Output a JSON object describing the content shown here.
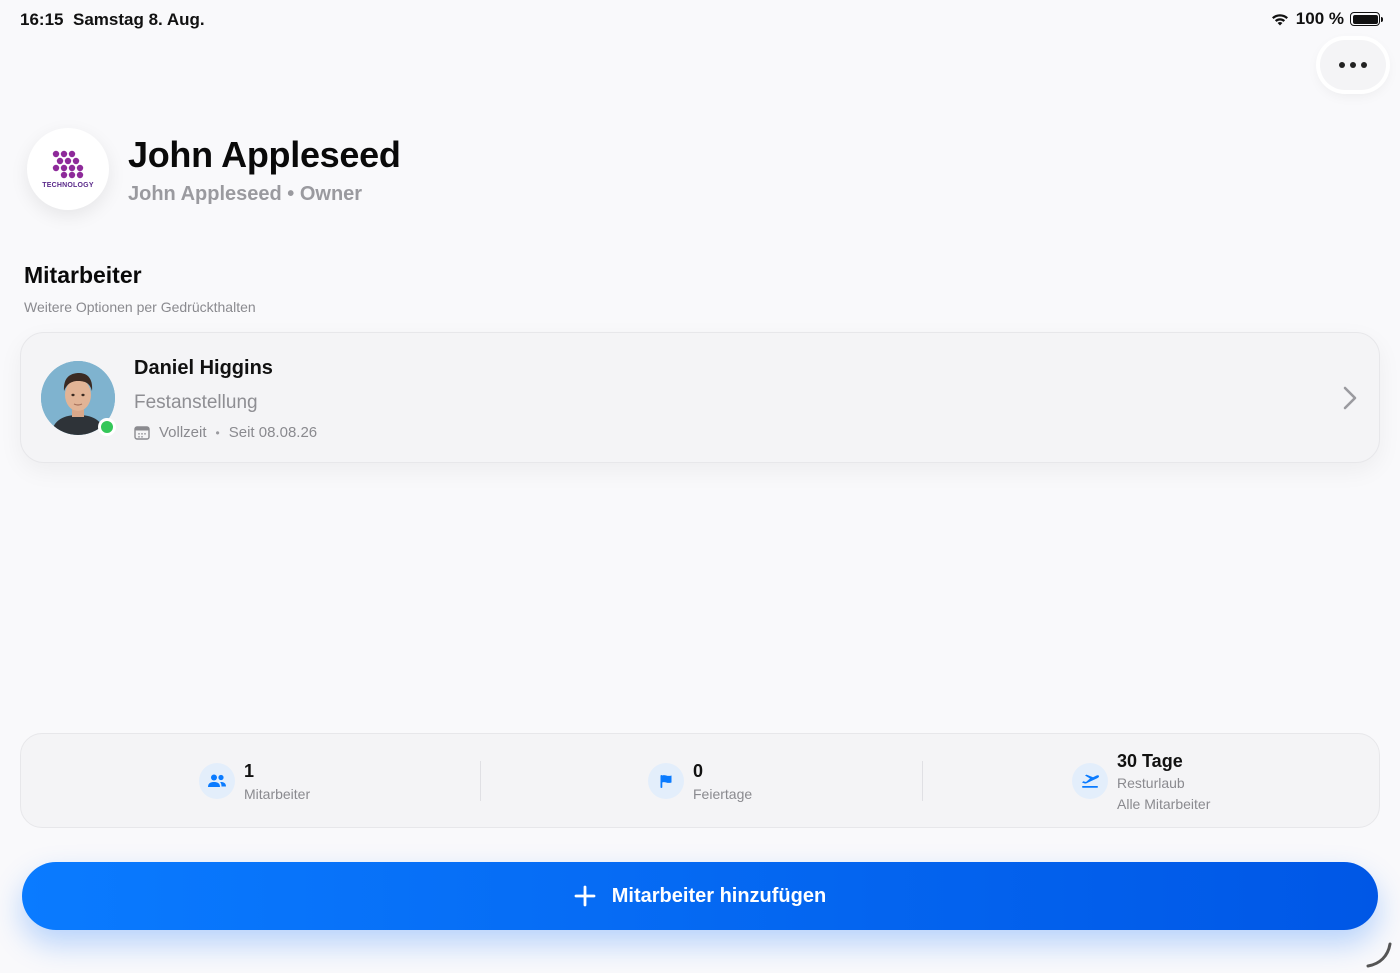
{
  "status_bar": {
    "time": "16:15",
    "date": "Samstag 8. Aug.",
    "battery": "100 %"
  },
  "header": {
    "logo_text": "TECHNOLOGY",
    "name": "John Appleseed",
    "subtitle": "John Appleseed • Owner"
  },
  "section": {
    "title": "Mitarbeiter",
    "subtitle": "Weitere Optionen per Gedrückthalten"
  },
  "employees": [
    {
      "name": "Daniel Higgins",
      "employment": "Festanstellung",
      "schedule": "Vollzeit",
      "since": "Seit 08.08.26",
      "online": true
    }
  ],
  "stats": [
    {
      "icon": "people-icon",
      "value": "1",
      "label": "Mitarbeiter",
      "sublabel": ""
    },
    {
      "icon": "flag-icon",
      "value": "0",
      "label": "Feiertage",
      "sublabel": ""
    },
    {
      "icon": "airplane-icon",
      "value": "30 Tage",
      "label": "Resturlaub",
      "sublabel": "Alle Mitarbeiter"
    }
  ],
  "add_button": {
    "label": "Mitarbeiter hinzufügen"
  },
  "colors": {
    "accent": "#0a7bff",
    "online": "#34c759",
    "background": "#f9f9fb",
    "logo": "#8e2a9a"
  }
}
